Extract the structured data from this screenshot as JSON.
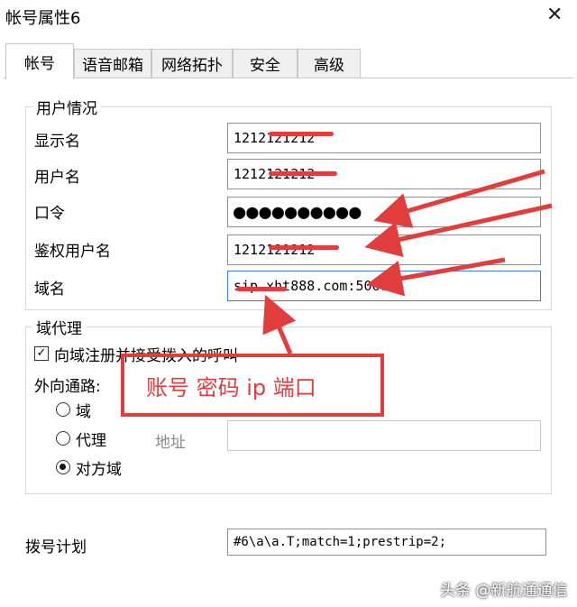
{
  "window": {
    "title": "帐号属性6",
    "close_symbol": "✕"
  },
  "tabs": [
    {
      "label": "帐号",
      "active": true
    },
    {
      "label": "语音邮箱",
      "active": false
    },
    {
      "label": "网络拓扑",
      "active": false
    },
    {
      "label": "安全",
      "active": false
    },
    {
      "label": "高级",
      "active": false
    }
  ],
  "user_group": {
    "title": "用户情况",
    "display_name": {
      "label": "显示名",
      "value": "1212121212"
    },
    "user_name": {
      "label": "用户名",
      "value": "1212121212"
    },
    "password": {
      "label": "口令",
      "value": "●●●●●●●●●●"
    },
    "auth_user": {
      "label": "鉴权用户名",
      "value": "1212121212"
    },
    "domain": {
      "label": "域名",
      "value": "sip.xht888.com:5060"
    }
  },
  "proxy_group": {
    "title": "域代理",
    "register_checkbox": {
      "label": "向域注册并接受拨入的呼叫",
      "checked": true
    },
    "outbound_label": "外向通路:",
    "options": [
      {
        "label": "域",
        "selected": false
      },
      {
        "label": "代理",
        "selected": false
      },
      {
        "label": "对方域",
        "selected": true
      }
    ],
    "address_label": "地址",
    "address_value": ""
  },
  "dial_plan": {
    "label": "拨号计划",
    "value": "#6\\a\\a.T;match=1;prestrip=2;"
  },
  "annotation": {
    "text": "账号 密码 ip 端口",
    "color": "#e23d3d"
  },
  "watermark": "头条 @新航通通信"
}
